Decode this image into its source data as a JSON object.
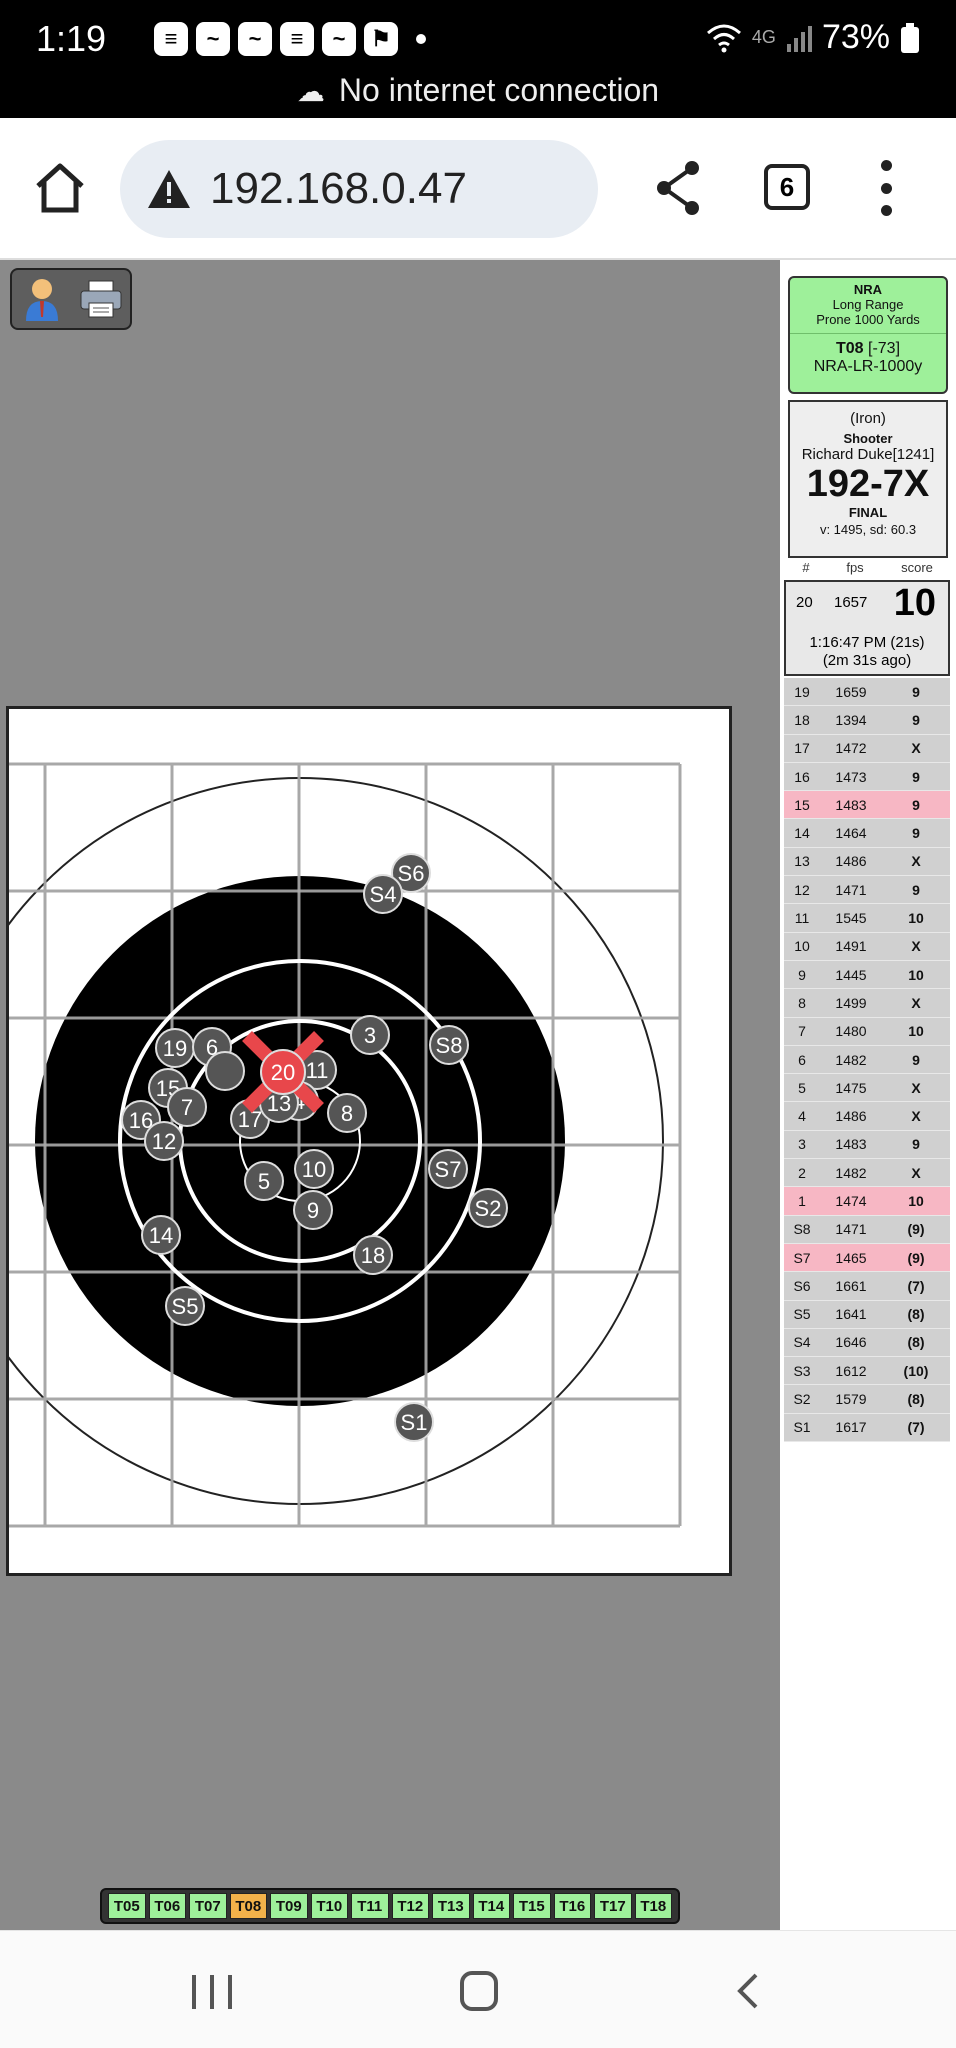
{
  "status_bar": {
    "time": "1:19",
    "notifications": [
      "≡",
      "~",
      "~",
      "≡",
      "~",
      "⚑"
    ],
    "network_type": "4G",
    "battery": "73%",
    "connection_message": "No internet connection"
  },
  "browser": {
    "url": "192.168.0.47",
    "tab_count": "6"
  },
  "match": {
    "org": "NRA",
    "discipline": "Long Range",
    "course": "Prone 1000 Yards",
    "target_id": "T08",
    "target_offset": "[-73]",
    "target_type": "NRA-LR-1000y"
  },
  "shooter": {
    "equipment": "(Iron)",
    "label": "Shooter",
    "name": "Richard Duke[1241]",
    "score": "192-7X",
    "status": "FINAL",
    "velocity_stats": "v: 1495, sd: 60.3"
  },
  "columns": {
    "num": "#",
    "fps": "fps",
    "score": "score"
  },
  "last_shot": {
    "num": "20",
    "fps": "1657",
    "score": "10",
    "time": "1:16:47 PM (21s)",
    "ago": "(2m 31s ago)"
  },
  "shots": [
    {
      "num": "19",
      "fps": "1659",
      "score": "9",
      "highlight": false
    },
    {
      "num": "18",
      "fps": "1394",
      "score": "9",
      "highlight": false
    },
    {
      "num": "17",
      "fps": "1472",
      "score": "X",
      "highlight": false
    },
    {
      "num": "16",
      "fps": "1473",
      "score": "9",
      "highlight": false
    },
    {
      "num": "15",
      "fps": "1483",
      "score": "9",
      "highlight": true
    },
    {
      "num": "14",
      "fps": "1464",
      "score": "9",
      "highlight": false
    },
    {
      "num": "13",
      "fps": "1486",
      "score": "X",
      "highlight": false
    },
    {
      "num": "12",
      "fps": "1471",
      "score": "9",
      "highlight": false
    },
    {
      "num": "11",
      "fps": "1545",
      "score": "10",
      "highlight": false
    },
    {
      "num": "10",
      "fps": "1491",
      "score": "X",
      "highlight": false
    },
    {
      "num": "9",
      "fps": "1445",
      "score": "10",
      "highlight": false
    },
    {
      "num": "8",
      "fps": "1499",
      "score": "X",
      "highlight": false
    },
    {
      "num": "7",
      "fps": "1480",
      "score": "10",
      "highlight": false
    },
    {
      "num": "6",
      "fps": "1482",
      "score": "9",
      "highlight": false
    },
    {
      "num": "5",
      "fps": "1475",
      "score": "X",
      "highlight": false
    },
    {
      "num": "4",
      "fps": "1486",
      "score": "X",
      "highlight": false
    },
    {
      "num": "3",
      "fps": "1483",
      "score": "9",
      "highlight": false
    },
    {
      "num": "2",
      "fps": "1482",
      "score": "X",
      "highlight": false
    },
    {
      "num": "1",
      "fps": "1474",
      "score": "10",
      "highlight": true
    },
    {
      "num": "S8",
      "fps": "1471",
      "score": "(9)",
      "highlight": false
    },
    {
      "num": "S7",
      "fps": "1465",
      "score": "(9)",
      "highlight": true
    },
    {
      "num": "S6",
      "fps": "1661",
      "score": "(7)",
      "highlight": false
    },
    {
      "num": "S5",
      "fps": "1641",
      "score": "(8)",
      "highlight": false
    },
    {
      "num": "S4",
      "fps": "1646",
      "score": "(8)",
      "highlight": false
    },
    {
      "num": "S3",
      "fps": "1612",
      "score": "(10)",
      "highlight": false
    },
    {
      "num": "S2",
      "fps": "1579",
      "score": "(8)",
      "highlight": false
    },
    {
      "num": "S1",
      "fps": "1617",
      "score": "(7)",
      "highlight": false
    }
  ],
  "target_tabs": [
    "T05",
    "T06",
    "T07",
    "T08",
    "T09",
    "T10",
    "T11",
    "T12",
    "T13",
    "T14",
    "T15",
    "T16",
    "T17",
    "T18"
  ],
  "active_target": "T08",
  "colors": {
    "match_box": "#9ef09a",
    "highlight_row": "#f7b7c4",
    "active_tab": "#f3b24a",
    "latest_shot_marker": "#e8474b"
  }
}
